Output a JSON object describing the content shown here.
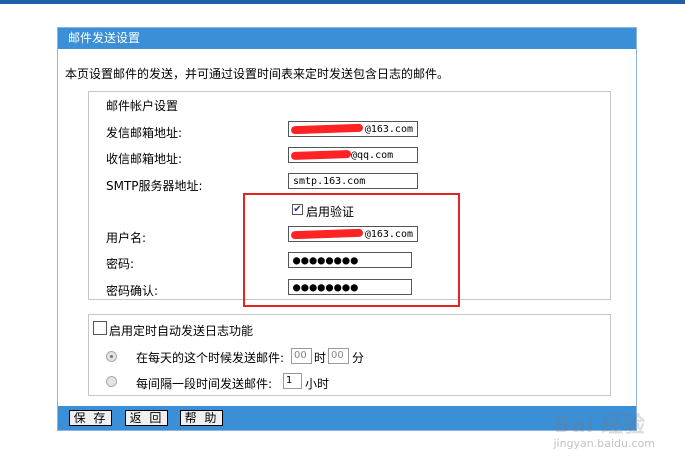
{
  "title": "邮件发送设置",
  "description": "本页设置邮件的发送，并可通过设置时间表来定时发送包含日志的邮件。",
  "account": {
    "legend": "邮件帐户设置",
    "from_label": "发信邮箱地址:",
    "from_value": "@163.com",
    "to_label": "收信邮箱地址:",
    "to_value": "@qq.com",
    "smtp_label": "SMTP服务器地址:",
    "smtp_value": "smtp.163.com",
    "auth_label": "启用验证",
    "auth_checked": true,
    "user_label": "用户名:",
    "user_value": "@163.com",
    "pwd_label": "密码:",
    "pwd_value": "●●●●●●●●",
    "pwd2_label": "密码确认:",
    "pwd2_value": "●●●●●●●●"
  },
  "schedule": {
    "enable_label": "启用定时自动发送日志功能",
    "enabled": false,
    "daily_label": "在每天的这个时候发送邮件:",
    "hour_value": "00",
    "hour_unit": "时",
    "minute_value": "00",
    "minute_unit": "分",
    "interval_label": "每间隔一段时间发送邮件:",
    "interval_value": "1",
    "interval_unit": "小时"
  },
  "buttons": {
    "save": "保 存",
    "back": "返 回",
    "help": "帮 助"
  },
  "watermark": {
    "logo": "Bai 经验",
    "url": "jingyan.baidu.com"
  },
  "colors": {
    "header": "#3a8fd6",
    "highlight": "#e32424"
  }
}
